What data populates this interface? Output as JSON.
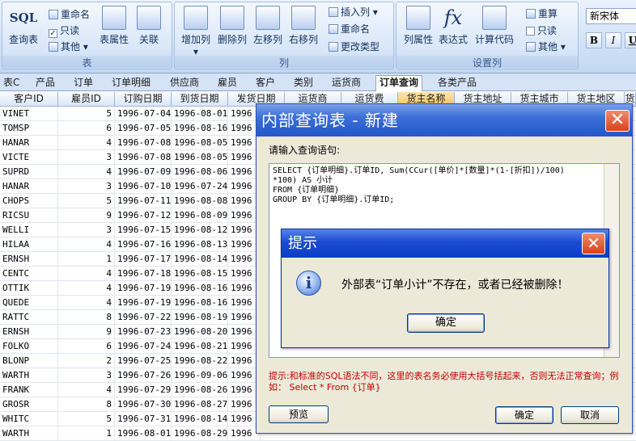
{
  "ribbon": {
    "group_table": {
      "caption": "表",
      "sql_icon_text": "SQL",
      "sql_query_label": "查询表",
      "rename_label": "重命名",
      "readonly_label": "只读",
      "other_label": "其他",
      "table_props_label": "表属性",
      "relations_label": "关联"
    },
    "group_column": {
      "caption": "列",
      "add_col_label": "增加列",
      "del_col_label": "删除列",
      "move_left_label": "左移列",
      "move_right_label": "右移列",
      "insert_col_label": "插入列",
      "rename_label": "重命名",
      "change_type_label": "更改类型"
    },
    "group_design": {
      "caption": "设置列",
      "col_props_label": "列属性",
      "expression_label": "表达式",
      "calc_code_label": "计算代码",
      "fx_icon_text": "fx",
      "recalc_label": "重算",
      "readonly_label": "只读",
      "other_label": "其他"
    },
    "font": {
      "name": "新宋体",
      "bold": "B",
      "italic": "I",
      "underline": "U"
    }
  },
  "tabs": [
    "表C",
    "产品",
    "订单",
    "订单明细",
    "供应商",
    "雇员",
    "客户",
    "类别",
    "运货商",
    "订单查询",
    "各类产品"
  ],
  "active_tab": "订单查询",
  "grid": {
    "columns": [
      "客户ID",
      "雇员ID",
      "订购日期",
      "到货日期",
      "发货日期",
      "运货商",
      "运货费",
      "货主名称",
      "货主地址",
      "货主城市",
      "货主地区",
      "货"
    ],
    "selected_column": "货主名称",
    "rows": [
      [
        "VINET",
        "5",
        "1996-07-04",
        "1996-08-01",
        "1996"
      ],
      [
        "TOMSP",
        "6",
        "1996-07-05",
        "1996-08-16",
        "1996"
      ],
      [
        "HANAR",
        "4",
        "1996-07-08",
        "1996-08-05",
        "1996"
      ],
      [
        "VICTE",
        "3",
        "1996-07-08",
        "1996-08-05",
        "1996"
      ],
      [
        "SUPRD",
        "4",
        "1996-07-09",
        "1996-08-06",
        "1996"
      ],
      [
        "HANAR",
        "3",
        "1996-07-10",
        "1996-07-24",
        "1996"
      ],
      [
        "CHOPS",
        "5",
        "1996-07-11",
        "1996-08-08",
        "1996"
      ],
      [
        "RICSU",
        "9",
        "1996-07-12",
        "1996-08-09",
        "1996"
      ],
      [
        "WELLI",
        "3",
        "1996-07-15",
        "1996-08-12",
        "1996"
      ],
      [
        "HILAA",
        "4",
        "1996-07-16",
        "1996-08-13",
        "1996"
      ],
      [
        "ERNSH",
        "1",
        "1996-07-17",
        "1996-08-14",
        "1996"
      ],
      [
        "CENTC",
        "4",
        "1996-07-18",
        "1996-08-15",
        "1996"
      ],
      [
        "OTTIK",
        "4",
        "1996-07-19",
        "1996-08-16",
        "1996"
      ],
      [
        "QUEDE",
        "4",
        "1996-07-19",
        "1996-08-16",
        "1996"
      ],
      [
        "RATTC",
        "8",
        "1996-07-22",
        "1996-08-19",
        "1996"
      ],
      [
        "ERNSH",
        "9",
        "1996-07-23",
        "1996-08-20",
        "1996"
      ],
      [
        "FOLKO",
        "6",
        "1996-07-24",
        "1996-08-21",
        "1996"
      ],
      [
        "BLONP",
        "2",
        "1996-07-25",
        "1996-08-22",
        "1996"
      ],
      [
        "WARTH",
        "3",
        "1996-07-26",
        "1996-09-06",
        "1996"
      ],
      [
        "FRANK",
        "4",
        "1996-07-29",
        "1996-08-26",
        "1996"
      ],
      [
        "GROSR",
        "8",
        "1996-07-30",
        "1996-08-27",
        "1996"
      ],
      [
        "WHITC",
        "5",
        "1996-07-31",
        "1996-08-14",
        "1996"
      ],
      [
        "WARTH",
        "1",
        "1996-08-01",
        "1996-08-29",
        "1996"
      ]
    ]
  },
  "query_dialog": {
    "title": "内部查询表 - 新建",
    "close_glyph": "✕",
    "prompt": "请输入查询语句:",
    "sql": "SELECT {订单明细}.订单ID, Sum(CCur([单价]*[数量]*(1-[折扣])/100)\n*100) AS 小计\nFROM {订单明细}\nGROUP BY {订单明细}.订单ID;",
    "hint": "提示:和标准的SQL语法不同，这里的表名务必使用大括号括起来，否则无法正常查询；例如： Select * From {订单}",
    "preview_label": "预览",
    "ok_label": "确定",
    "cancel_label": "取消"
  },
  "alert_dialog": {
    "title": "提示",
    "close_glyph": "✕",
    "icon_glyph": "i",
    "message": "外部表“订单小计”不存在，或者已经被删除！",
    "ok_label": "确定"
  },
  "colors": {
    "title_bar": "#2456c8",
    "hint_text": "#c00000",
    "selected_header": "#f7c768"
  }
}
